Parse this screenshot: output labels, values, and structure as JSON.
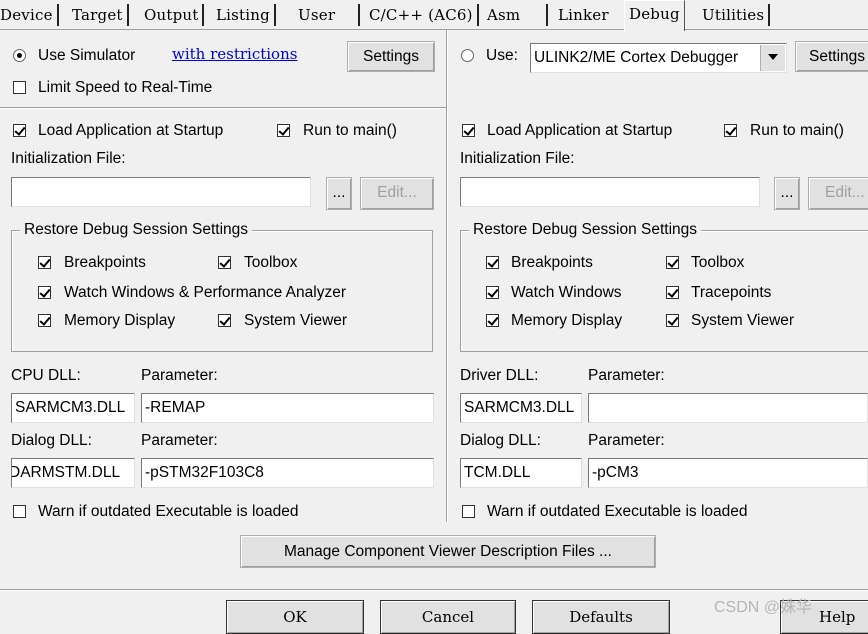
{
  "tabs": [
    {
      "label": "Device"
    },
    {
      "label": "Target"
    },
    {
      "label": "Output"
    },
    {
      "label": "Listing"
    },
    {
      "label": "User"
    },
    {
      "label": "C/C++ (AC6)"
    },
    {
      "label": "Asm"
    },
    {
      "label": "Linker"
    },
    {
      "label": "Debug",
      "active": true
    },
    {
      "label": "Utilities"
    }
  ],
  "left": {
    "use_simulator": {
      "label": "Use Simulator",
      "selected": true
    },
    "restrictions_link": "with restrictions",
    "settings_label": "Settings",
    "limit_speed": {
      "label": "Limit Speed to Real-Time",
      "checked": false
    },
    "load_app": {
      "label": "Load Application at Startup",
      "checked": true
    },
    "run_to_main": {
      "label": "Run to main()",
      "checked": true
    },
    "init_file_label": "Initialization File:",
    "init_file_value": "",
    "browse_label": "...",
    "edit_label": "Edit...",
    "restore_title": "Restore Debug Session Settings",
    "breakpoints": {
      "label": "Breakpoints",
      "checked": true
    },
    "toolbox": {
      "label": "Toolbox",
      "checked": true
    },
    "watch_windows": {
      "label": "Watch Windows & Performance Analyzer",
      "checked": true
    },
    "memory_display": {
      "label": "Memory Display",
      "checked": true
    },
    "system_viewer": {
      "label": "System Viewer",
      "checked": true
    },
    "cpu_dll_label": "CPU DLL:",
    "cpu_param_label": "Parameter:",
    "cpu_dll_value": "SARMCM3.DLL",
    "cpu_param_value": "-REMAP",
    "dialog_dll_label": "Dialog DLL:",
    "dialog_param_label": "Parameter:",
    "dialog_dll_value": "DARMSTM.DLL",
    "dialog_param_value": "-pSTM32F103C8",
    "warn_outdated": {
      "label": "Warn if outdated Executable is loaded",
      "checked": false
    }
  },
  "right": {
    "use": {
      "label": "Use:",
      "selected": false
    },
    "debugger_value": "ULINK2/ME Cortex Debugger",
    "settings_label": "Settings",
    "load_app": {
      "label": "Load Application at Startup",
      "checked": true
    },
    "run_to_main": {
      "label": "Run to main()",
      "checked": true
    },
    "init_file_label": "Initialization File:",
    "init_file_value": "",
    "browse_label": "...",
    "edit_label": "Edit...",
    "restore_title": "Restore Debug Session Settings",
    "breakpoints": {
      "label": "Breakpoints",
      "checked": true
    },
    "toolbox": {
      "label": "Toolbox",
      "checked": true
    },
    "watch_windows": {
      "label": "Watch Windows",
      "checked": true
    },
    "tracepoints": {
      "label": "Tracepoints",
      "checked": true
    },
    "memory_display": {
      "label": "Memory Display",
      "checked": true
    },
    "system_viewer": {
      "label": "System Viewer",
      "checked": true
    },
    "driver_dll_label": "Driver DLL:",
    "driver_param_label": "Parameter:",
    "driver_dll_value": "SARMCM3.DLL",
    "driver_param_value": "",
    "dialog_dll_label": "Dialog DLL:",
    "dialog_param_label": "Parameter:",
    "dialog_dll_value": "TCM.DLL",
    "dialog_param_value": "-pCM3",
    "warn_outdated": {
      "label": "Warn if outdated Executable is loaded",
      "checked": false
    }
  },
  "manage_button": "Manage Component Viewer Description Files ...",
  "footer": {
    "ok": "OK",
    "cancel": "Cancel",
    "defaults": "Defaults",
    "help": "Help"
  },
  "watermark": "CSDN @姝华"
}
